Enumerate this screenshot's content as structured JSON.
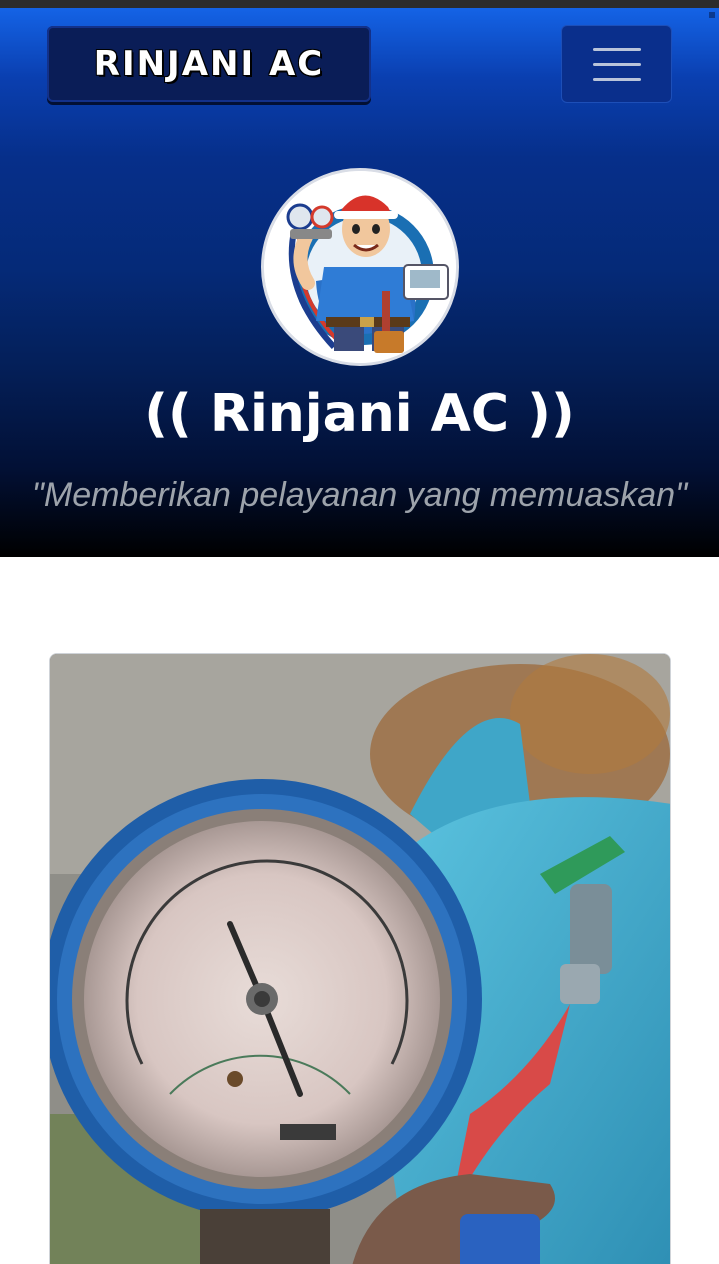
{
  "navbar": {
    "brand_label": "RINJANI AC",
    "menu_icon": "hamburger-menu-icon"
  },
  "hero": {
    "logo_icon": "ac-technician-mascot-icon",
    "title": "(( Rinjani AC ))",
    "tagline": "\"Memberikan pelayanan yang memuaskan\""
  },
  "content": {
    "photo_icon": "pressure-gauge-freon-tank-photo"
  },
  "colors": {
    "hero_top": "#1463e6",
    "hero_mid": "#052a78",
    "hero_bottom": "#000000",
    "brand_bg": "#0a1d57",
    "tagline": "#9da3ab"
  }
}
